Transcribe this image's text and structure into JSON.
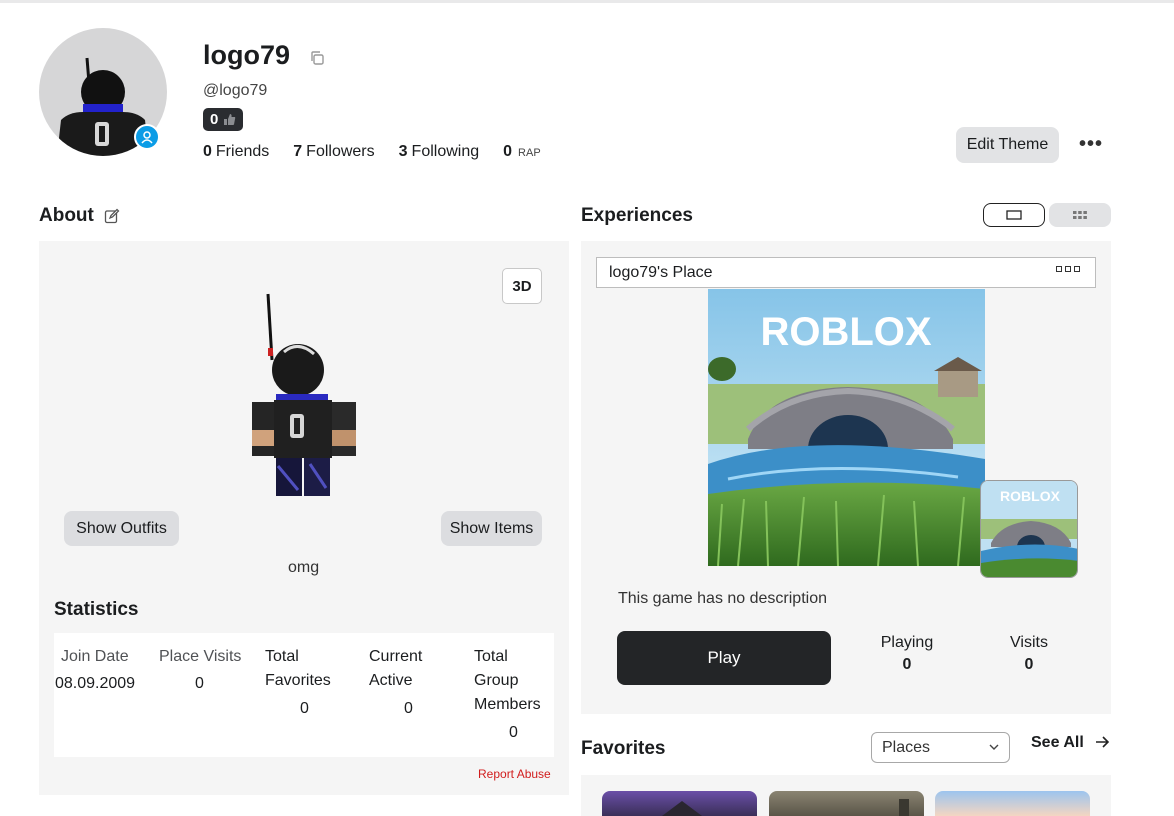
{
  "profile": {
    "username": "logo79",
    "handle": "@logo79",
    "badge_count": "0",
    "friends_count": "0",
    "friends_label": "Friends",
    "followers_count": "7",
    "followers_label": "Followers",
    "following_count": "3",
    "following_label": "Following",
    "rap_count": "0",
    "rap_label": "RAP"
  },
  "actions": {
    "edit_theme": "Edit Theme",
    "more": "•••"
  },
  "about": {
    "title": "About",
    "btn_3d": "3D",
    "show_outfits": "Show Outfits",
    "show_items": "Show Items",
    "description": "omg",
    "statistics_title": "Statistics",
    "stats": {
      "join_date_label": "Join Date",
      "join_date_value": "08.09.2009",
      "place_visits_label": "Place Visits",
      "place_visits_value": "0",
      "total_favorites_label_1": "Total",
      "total_favorites_label_2": "Favorites",
      "total_favorites_value": "0",
      "current_active_label_1": "Current",
      "current_active_label_2": "Active",
      "current_active_value": "0",
      "group_members_label_1": "Total",
      "group_members_label_2": "Group",
      "group_members_label_3": "Members",
      "group_members_value": "0"
    },
    "report_abuse": "Report Abuse"
  },
  "experiences": {
    "title": "Experiences",
    "place_name": "logo79's Place",
    "thumb_logo": "ROBLOX",
    "no_description": "This game has no description",
    "play": "Play",
    "playing_label": "Playing",
    "playing_value": "0",
    "visits_label": "Visits",
    "visits_value": "0"
  },
  "favorites": {
    "title": "Favorites",
    "filter": "Places",
    "see_all": "See All"
  },
  "colors": {
    "accent_blue": "#0b9ce6",
    "play_button": "#232527",
    "report_red": "#d11d1d",
    "panel_bg": "#f5f5f5"
  },
  "icons": {
    "copy": "copy-icon",
    "edit": "pencil-icon",
    "status": "user-status-icon",
    "thumbs_up": "thumbs-up-icon",
    "arrow": "arrow-right-icon",
    "chevron": "chevron-down-icon"
  }
}
